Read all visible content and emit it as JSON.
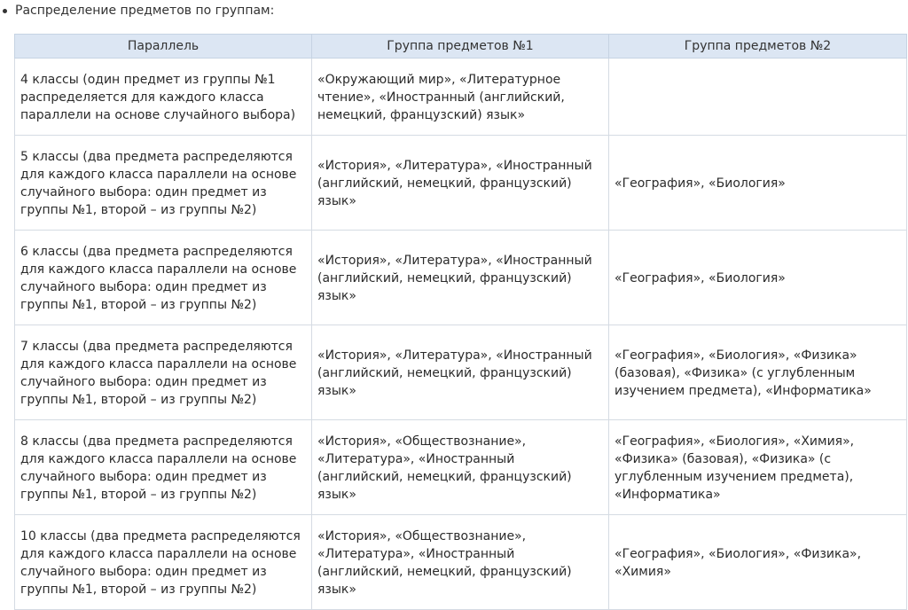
{
  "intro": "Распределение предметов по группам:",
  "table": {
    "headers": [
      "Параллель",
      "Группа предметов №1",
      "Группа предметов №2"
    ],
    "rows": [
      [
        "4 классы (один предмет из группы №1 распределяется для каждого класса параллели на основе случайного выбора)",
        "«Окружающий мир», «Литературное чтение», «Иностранный (английский, немецкий, французский) язык»",
        ""
      ],
      [
        "5 классы (два предмета распределяются для каждого класса параллели на основе случайного выбора: один предмет из группы №1, второй – из группы №2)",
        "«История», «Литература», «Иностранный (английский, немецкий, французский) язык»",
        "«География», «Биология»"
      ],
      [
        "6 классы (два предмета распределяются для каждого класса параллели на основе случайного выбора: один предмет из группы №1, второй – из группы №2)",
        "«История», «Литература», «Иностранный (английский, немецкий, французский) язык»",
        "«География», «Биология»"
      ],
      [
        "7 классы (два предмета распределяются для каждого класса параллели на основе случайного выбора: один предмет из группы №1, второй – из группы №2)",
        "«История», «Литература», «Иностранный (английский, немецкий, французский) язык»",
        "«География», «Биология», «Физика» (базовая), «Физика» (с углубленным изучением предмета), «Информатика»"
      ],
      [
        "8 классы (два предмета распределяются для каждого класса параллели на основе случайного выбора: один предмет из группы №1, второй – из группы №2)",
        "«История», «Обществознание», «Литература», «Иностранный (английский, немецкий, французский) язык»",
        "«География», «Биология», «Химия», «Физика» (базовая), «Физика» (с углубленным изучением предмета), «Информатика»"
      ],
      [
        "10 классы (два предмета распределяются для каждого класса параллели на основе случайного выбора: один предмет из группы №1, второй – из группы №2)",
        "«История», «Обществознание», «Литература», «Иностранный (английский, немецкий, французский) язык»",
        "«География», «Биология», «Физика», «Химия»"
      ]
    ]
  }
}
